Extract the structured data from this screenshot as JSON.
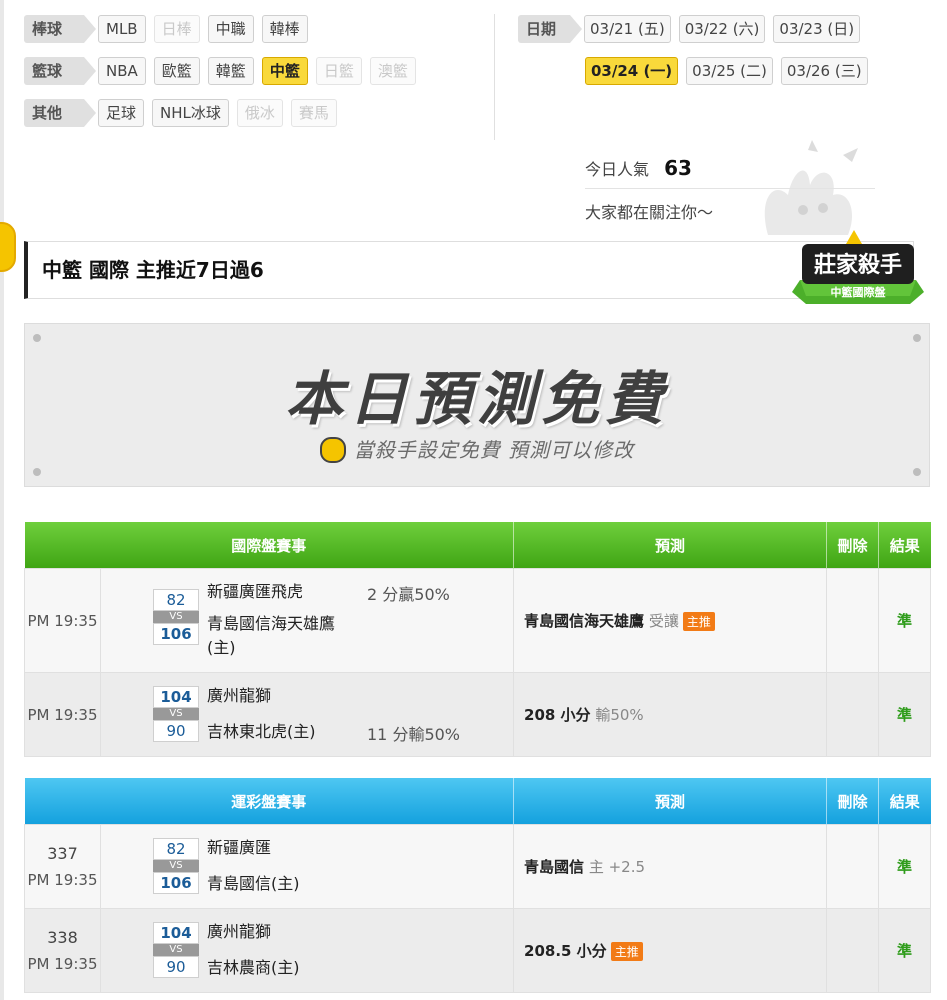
{
  "filters": {
    "baseball": {
      "label": "棒球",
      "chips": [
        {
          "label": "MLB",
          "state": "normal"
        },
        {
          "label": "日棒",
          "state": "disabled"
        },
        {
          "label": "中職",
          "state": "normal"
        },
        {
          "label": "韓棒",
          "state": "normal"
        }
      ]
    },
    "basketball": {
      "label": "籃球",
      "chips": [
        {
          "label": "NBA",
          "state": "normal"
        },
        {
          "label": "歐籃",
          "state": "normal"
        },
        {
          "label": "韓籃",
          "state": "normal"
        },
        {
          "label": "中籃",
          "state": "active"
        },
        {
          "label": "日籃",
          "state": "disabled"
        },
        {
          "label": "澳籃",
          "state": "disabled"
        }
      ]
    },
    "other": {
      "label": "其他",
      "chips": [
        {
          "label": "足球",
          "state": "normal"
        },
        {
          "label": "NHL冰球",
          "state": "normal"
        },
        {
          "label": "俄冰",
          "state": "disabled"
        },
        {
          "label": "賽馬",
          "state": "disabled"
        }
      ]
    }
  },
  "dates": {
    "label": "日期",
    "row1": [
      {
        "label": "03/21 (五)",
        "state": "normal"
      },
      {
        "label": "03/22 (六)",
        "state": "normal"
      },
      {
        "label": "03/23 (日)",
        "state": "normal"
      }
    ],
    "row2": [
      {
        "label": "03/24 (一)",
        "state": "active"
      },
      {
        "label": "03/25 (二)",
        "state": "normal"
      },
      {
        "label": "03/26 (三)",
        "state": "normal"
      }
    ]
  },
  "popularity": {
    "label": "今日人氣",
    "count": "63",
    "tagline": "大家都在關注你～"
  },
  "killer": {
    "title": "中籃 國際 主推近7日過6",
    "badge_main": "莊家殺手",
    "badge_sub": "中籃國際盤"
  },
  "banner": {
    "title": "本日預測免費",
    "subtitle": "當殺手設定免費 預測可以修改"
  },
  "intl_table": {
    "headers": {
      "event": "國際盤賽事",
      "prediction": "預測",
      "delete": "刪除",
      "result": "結果"
    },
    "rows": [
      {
        "time": "PM 19:35",
        "score1": "82",
        "score2": "106",
        "vs": "VS",
        "team1": "新疆廣匯飛虎",
        "team2": "青島國信海天雄鷹",
        "team2b": "(主)",
        "odds": "2 分贏50%",
        "pred_main": "青島國信海天雄鷹",
        "pred_extra": "受讓",
        "pred_tag": "主推",
        "result": "準"
      },
      {
        "time": "PM 19:35",
        "score1": "104",
        "score2": "90",
        "vs": "VS",
        "team1": "廣州龍獅",
        "team2": "吉林東北虎(主)",
        "odds": "11 分輸50%",
        "pred_main": "208 小分",
        "pred_extra": "輸50%",
        "result": "準"
      }
    ]
  },
  "lottery_table": {
    "headers": {
      "event": "運彩盤賽事",
      "prediction": "預測",
      "delete": "刪除",
      "result": "結果"
    },
    "rows": [
      {
        "num": "337",
        "time": "PM 19:35",
        "score1": "82",
        "score2": "106",
        "vs": "VS",
        "team1": "新疆廣匯",
        "team2": "青島國信(主)",
        "pred_main": "青島國信",
        "pred_extra": "主 +2.5",
        "result": "準"
      },
      {
        "num": "338",
        "time": "PM 19:35",
        "score1": "104",
        "score2": "90",
        "vs": "VS",
        "team1": "廣州龍獅",
        "team2": "吉林農商(主)",
        "pred_main": "208.5 小分",
        "pred_tag": "主推",
        "result": "準"
      }
    ]
  }
}
